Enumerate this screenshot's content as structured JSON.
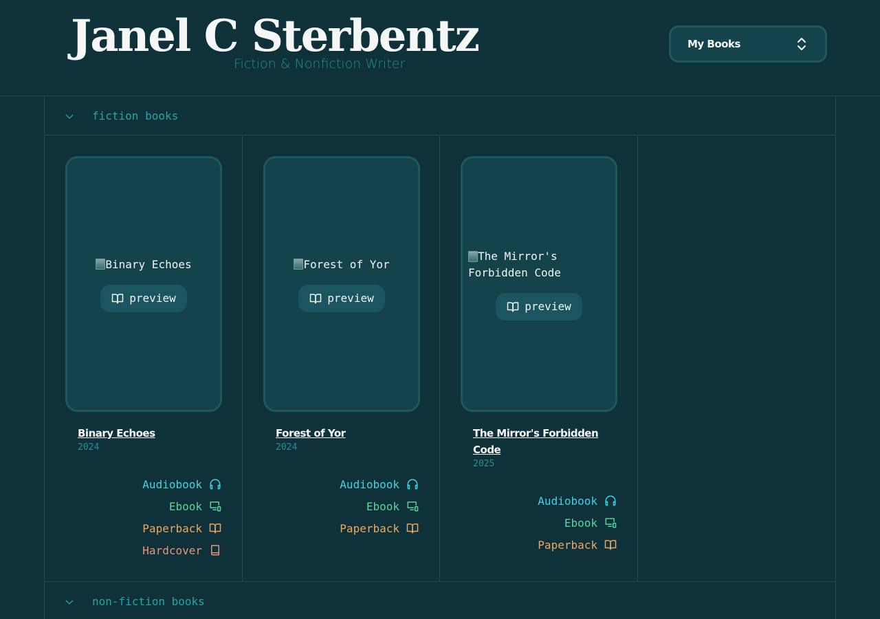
{
  "header": {
    "title": "Janel C Sterbentz",
    "subtitle": "Fiction & Nonfiction Writer",
    "select_label": "My Books"
  },
  "sections": [
    {
      "title": "fiction books"
    },
    {
      "title": "non-fiction books"
    }
  ],
  "preview_label": "preview",
  "books": [
    {
      "title": "Binary Echoes",
      "cover_alt": "Binary Echoes",
      "year": "2024",
      "formats": [
        "Audiobook",
        "Ebook",
        "Paperback",
        "Hardcover"
      ]
    },
    {
      "title": "Forest of Yor",
      "cover_alt": "Forest of Yor",
      "year": "2024",
      "formats": [
        "Audiobook",
        "Ebook",
        "Paperback"
      ]
    },
    {
      "title": "The Mirror's Forbidden Code",
      "cover_alt": "The Mirror's Forbidden Code",
      "year": "2025",
      "formats": [
        "Audiobook",
        "Ebook",
        "Paperback"
      ]
    }
  ],
  "colors": {
    "background": "#0e313a",
    "card": "#14434c",
    "accent": "#2aa3a8",
    "audiobook": "#45d1e1",
    "ebook": "#5ad39a",
    "paperback": "#e9a864",
    "hardcover": "#e79778"
  },
  "icons": {
    "audiobook": "headphones-icon",
    "ebook": "device-icon",
    "paperback": "open-book-icon",
    "hardcover": "closed-book-icon",
    "preview": "open-book-icon",
    "section": "chevron-down-icon",
    "select": "chevron-up-down-icon"
  }
}
